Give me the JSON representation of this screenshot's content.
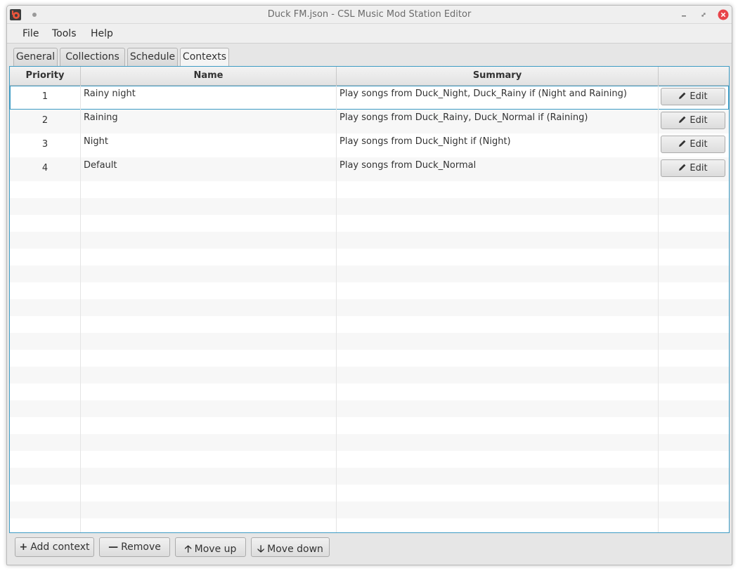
{
  "window": {
    "title": "Duck FM.json - CSL Music Mod Station Editor"
  },
  "menu": {
    "items": [
      "File",
      "Tools",
      "Help"
    ]
  },
  "tabs": [
    {
      "label": "General",
      "active": false
    },
    {
      "label": "Collections",
      "active": false
    },
    {
      "label": "Schedule",
      "active": false
    },
    {
      "label": "Contexts",
      "active": true
    }
  ],
  "table": {
    "columns": [
      "Priority",
      "Name",
      "Summary",
      ""
    ],
    "rows": [
      {
        "priority": "1",
        "name": "Rainy night",
        "summary": "Play songs from Duck_Night, Duck_Rainy if (Night and Raining)",
        "action": "Edit",
        "selected": true
      },
      {
        "priority": "2",
        "name": "Raining",
        "summary": "Play songs from Duck_Rainy, Duck_Normal if (Raining)",
        "action": "Edit",
        "selected": false
      },
      {
        "priority": "3",
        "name": "Night",
        "summary": "Play songs from Duck_Night if (Night)",
        "action": "Edit",
        "selected": false
      },
      {
        "priority": "4",
        "name": "Default",
        "summary": "Play songs from Duck_Normal",
        "action": "Edit",
        "selected": false
      }
    ]
  },
  "bottom": {
    "add_label": "Add context",
    "remove_label": "Remove",
    "move_up_label": "Move up",
    "move_down_label": "Move down"
  },
  "colors": {
    "accent": "#3d9bc4",
    "close": "#e8444a"
  },
  "icons": {
    "edit": "pencil-icon",
    "add": "plus-icon",
    "remove": "minus-icon",
    "move_up": "arrow-up-icon",
    "move_down": "arrow-down-icon"
  }
}
